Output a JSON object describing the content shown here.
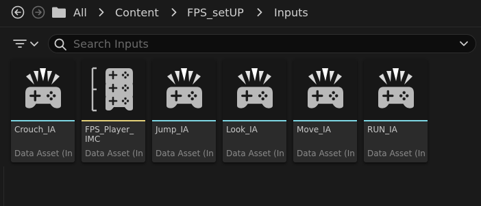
{
  "breadcrumb": {
    "items": [
      "All",
      "Content",
      "FPS_setUP",
      "Inputs"
    ]
  },
  "search": {
    "placeholder": "Search Inputs"
  },
  "colors": {
    "input_action_bar": "#7fd9e6",
    "mapping_context_bar": "#e6d27a"
  },
  "assets": [
    {
      "name": "Crouch_IA",
      "type": "Data Asset (In...",
      "icon": "input-action-icon",
      "kind": "action"
    },
    {
      "name": "FPS_Player_\nIMC",
      "type": "Data Asset (In...",
      "icon": "input-mapping-context-icon",
      "kind": "mapping"
    },
    {
      "name": "Jump_IA",
      "type": "Data Asset (In...",
      "icon": "input-action-icon",
      "kind": "action"
    },
    {
      "name": "Look_IA",
      "type": "Data Asset (In...",
      "icon": "input-action-icon",
      "kind": "action"
    },
    {
      "name": "Move_IA",
      "type": "Data Asset (In...",
      "icon": "input-action-icon",
      "kind": "action"
    },
    {
      "name": "RUN_IA",
      "type": "Data Asset (In...",
      "icon": "input-action-icon",
      "kind": "action"
    }
  ]
}
